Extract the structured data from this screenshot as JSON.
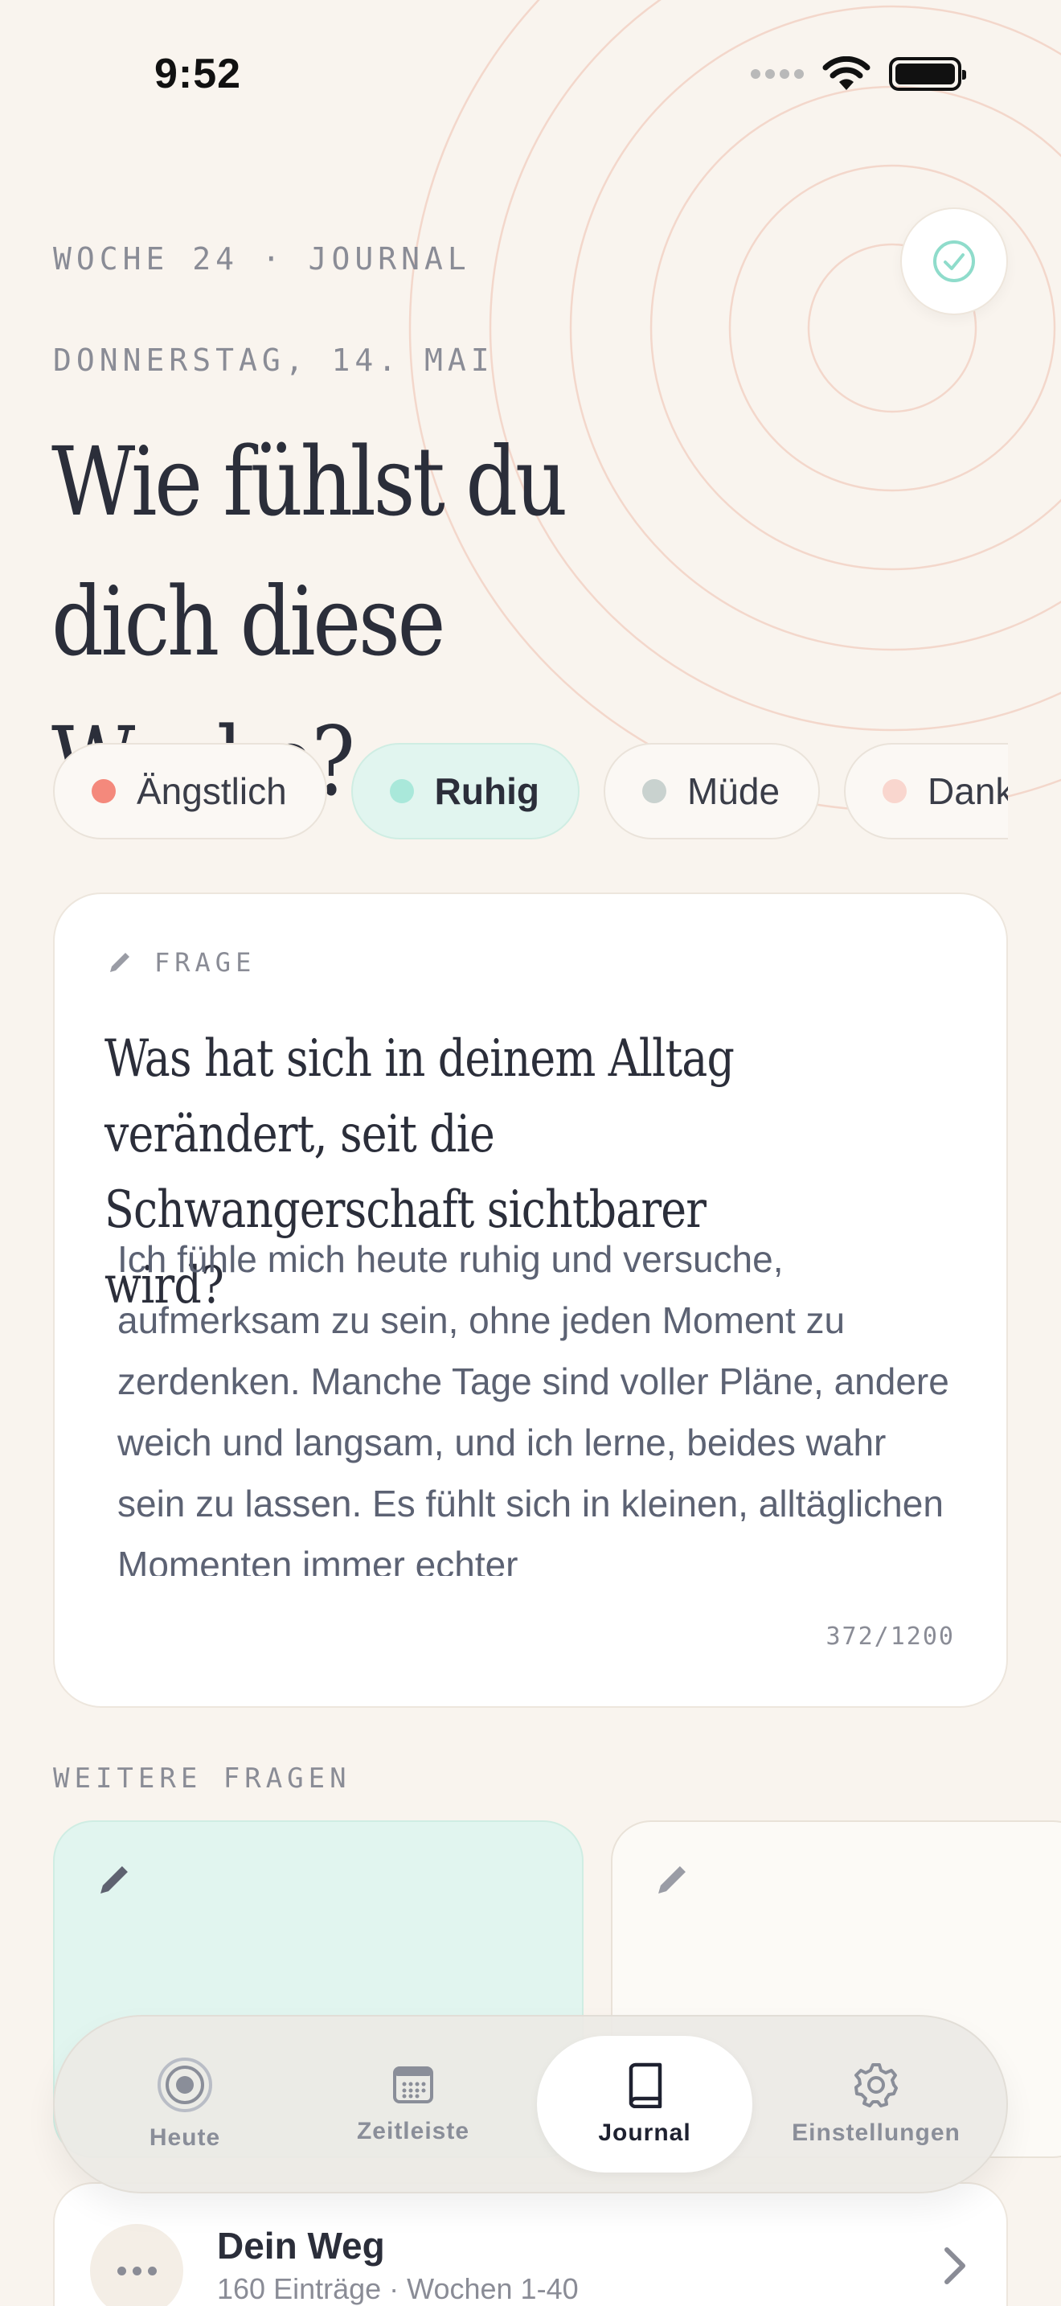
{
  "status_bar": {
    "time": "9:52"
  },
  "header": {
    "week_label": "WOCHE 24 · JOURNAL",
    "date_label": "DONNERSTAG, 14. MAI",
    "headline": "Wie fühlst du dich diese Woche?",
    "done_icon": "check-circle-icon"
  },
  "moods": [
    {
      "label": "Ängstlich",
      "color": "#F4897C",
      "active": false
    },
    {
      "label": "Ruhig",
      "color": "#A9E8DA",
      "active": true
    },
    {
      "label": "Müde",
      "color": "#C9D2CF",
      "active": false
    },
    {
      "label": "Dankbar",
      "color": "#F9D6CE",
      "active": false
    }
  ],
  "question_card": {
    "tag": "FRAGE",
    "question": "Was hat sich in deinem Alltag verändert, seit die Schwangerschaft sichtbarer wird?",
    "answer": "Ich fühle mich heute ruhig und versuche, aufmerksam zu sein, ohne jeden Moment zu zerdenken. Manche Tage sind voller Pläne, andere weich und langsam, und ich lerne, beides wahr sein zu lassen. Es fühlt sich in kleinen, alltäglichen Momenten immer echter",
    "counter": "372/1200"
  },
  "more_questions": {
    "label": "WEITERE FRAGEN"
  },
  "tabbar": {
    "tabs": [
      {
        "label": "Heute",
        "icon": "rings-icon",
        "active": false
      },
      {
        "label": "Zeitleiste",
        "icon": "calendar-icon",
        "active": false
      },
      {
        "label": "Journal",
        "icon": "book-icon",
        "active": true
      },
      {
        "label": "Einstellungen",
        "icon": "gear-icon",
        "active": false
      }
    ]
  },
  "bottom_card": {
    "title": "Dein Weg",
    "subtitle": "160 Einträge · Wochen 1-40"
  },
  "colors": {
    "background": "#F9F4EE",
    "accent_mint": "#E1F5EF",
    "ring": "#F3CDBF"
  }
}
